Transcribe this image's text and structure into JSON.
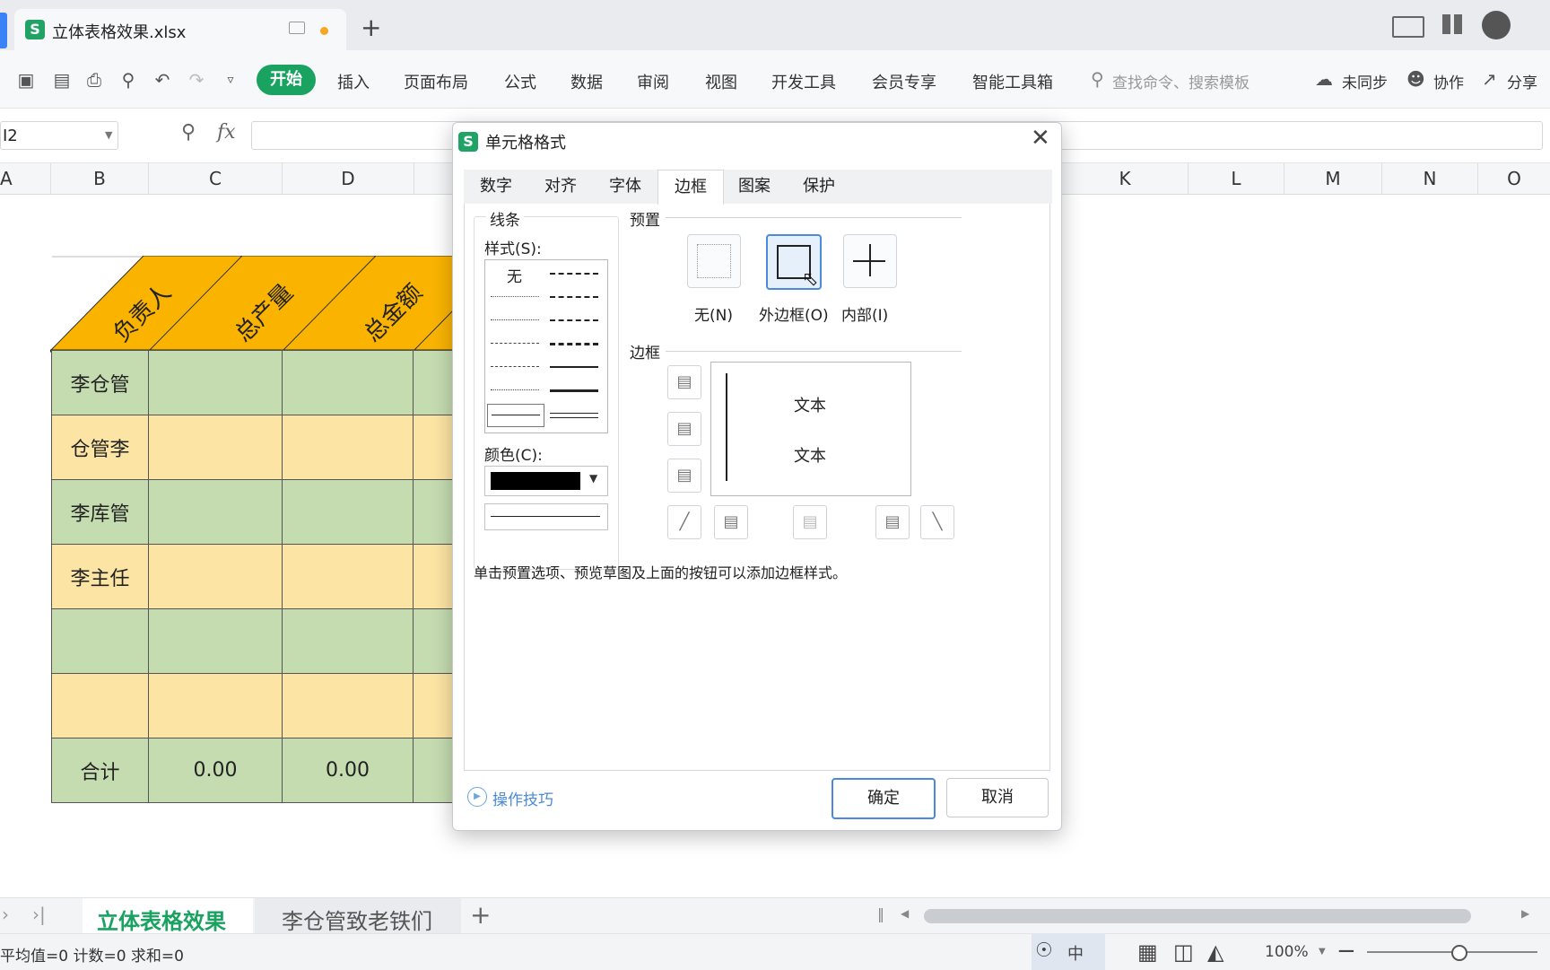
{
  "window": {
    "file_tab": "立体表格效果.xlsx",
    "new_tab": "+"
  },
  "ribbon": {
    "menus": [
      "开始",
      "插入",
      "页面布局",
      "公式",
      "数据",
      "审阅",
      "视图",
      "开发工具",
      "会员专享",
      "智能工具箱"
    ],
    "search_placeholder": "查找命令、搜索模板",
    "sync": "未同步",
    "collab": "协作",
    "share": "分享"
  },
  "formula_bar": {
    "name_box": "I2",
    "fx": "fx"
  },
  "columns": [
    "A",
    "B",
    "C",
    "D",
    "K",
    "L",
    "M",
    "N",
    "O"
  ],
  "sheet": {
    "headers": [
      "负责人",
      "总产量",
      "总金额"
    ],
    "rows": [
      "李仓管",
      "仓管李",
      "李库管",
      "李主任"
    ],
    "total_label": "合计",
    "total_values": [
      "0.00",
      "0.00"
    ]
  },
  "dialog": {
    "title": "单元格格式",
    "tabs": [
      "数字",
      "对齐",
      "字体",
      "边框",
      "图案",
      "保护"
    ],
    "active_tab": "边框",
    "line_group": "线条",
    "style_label": "样式(S):",
    "style_none": "无",
    "color_label": "颜色(C):",
    "color_value": "#000000",
    "preset_label": "预置",
    "presets": [
      "无(N)",
      "外边框(O)",
      "内部(I)"
    ],
    "border_label": "边框",
    "preview_text": [
      "文本",
      "文本"
    ],
    "hint": "单击预置选项、预览草图及上面的按钮可以添加边框样式。",
    "tips": "操作技巧",
    "ok": "确定",
    "cancel": "取消"
  },
  "sheet_tabs": [
    "立体表格效果",
    "李仓管致老铁们"
  ],
  "status": {
    "stats": "平均值=0  计数=0  求和=0",
    "zoom": "100%",
    "lang": "中"
  },
  "colors": {
    "accent": "#1aa260",
    "header_orange": "#fab400",
    "row_green": "#c5dcb0",
    "row_yellow": "#fce5a4"
  }
}
